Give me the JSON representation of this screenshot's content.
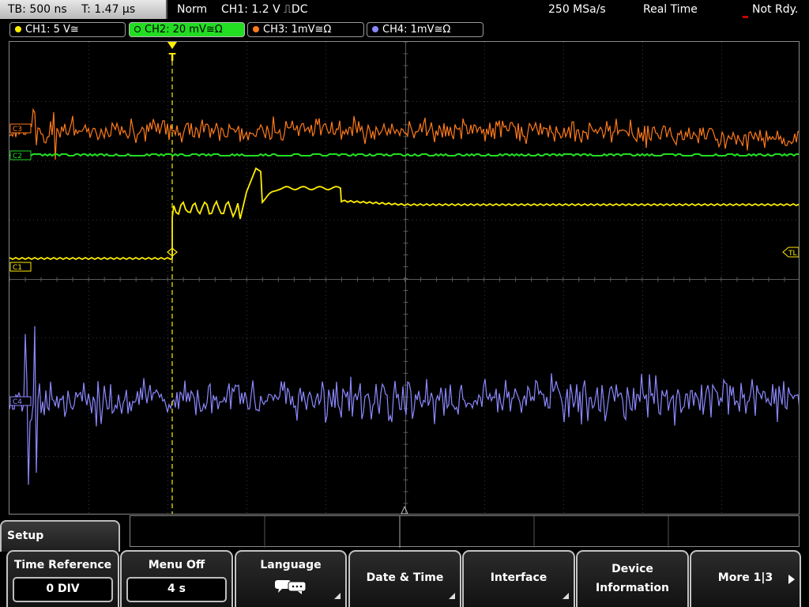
{
  "topbar": {
    "timebase": "TB: 500 ns",
    "trigger_time": "T: 1.47 µs",
    "mode": "Norm",
    "trigger": "CH1: 1.2 V ⎍DC",
    "sample_rate": "250 MSa/s",
    "acquisition": "Real Time",
    "state": "Not Rdy."
  },
  "channels": [
    {
      "label": "CH1: 5 V≅",
      "color": "#ffee00"
    },
    {
      "label": "CH2: 20 mV≅Ω",
      "color": "#22dd22"
    },
    {
      "label": "CH3: 1mV≅Ω",
      "color": "#ff7a1a"
    },
    {
      "label": "CH4: 1mV≅Ω",
      "color": "#8c88ff"
    }
  ],
  "markers": {
    "ch1_label": "C1",
    "ch2_label": "C2",
    "ch3_label": "C3",
    "ch4_label": "C4",
    "trigger_level": "TL",
    "trigger_pos": "T"
  },
  "setup_menu": {
    "title": "Setup",
    "time_reference": {
      "label": "Time Reference",
      "value": "0 DIV"
    },
    "menu_off": {
      "label": "Menu Off",
      "value": "4 s"
    },
    "language": {
      "label": "Language"
    },
    "date_time": {
      "label": "Date & Time"
    },
    "interface": {
      "label": "Interface"
    },
    "device_info": {
      "line1": "Device",
      "line2": "Information"
    },
    "more": {
      "label": "More 1|3"
    }
  }
}
